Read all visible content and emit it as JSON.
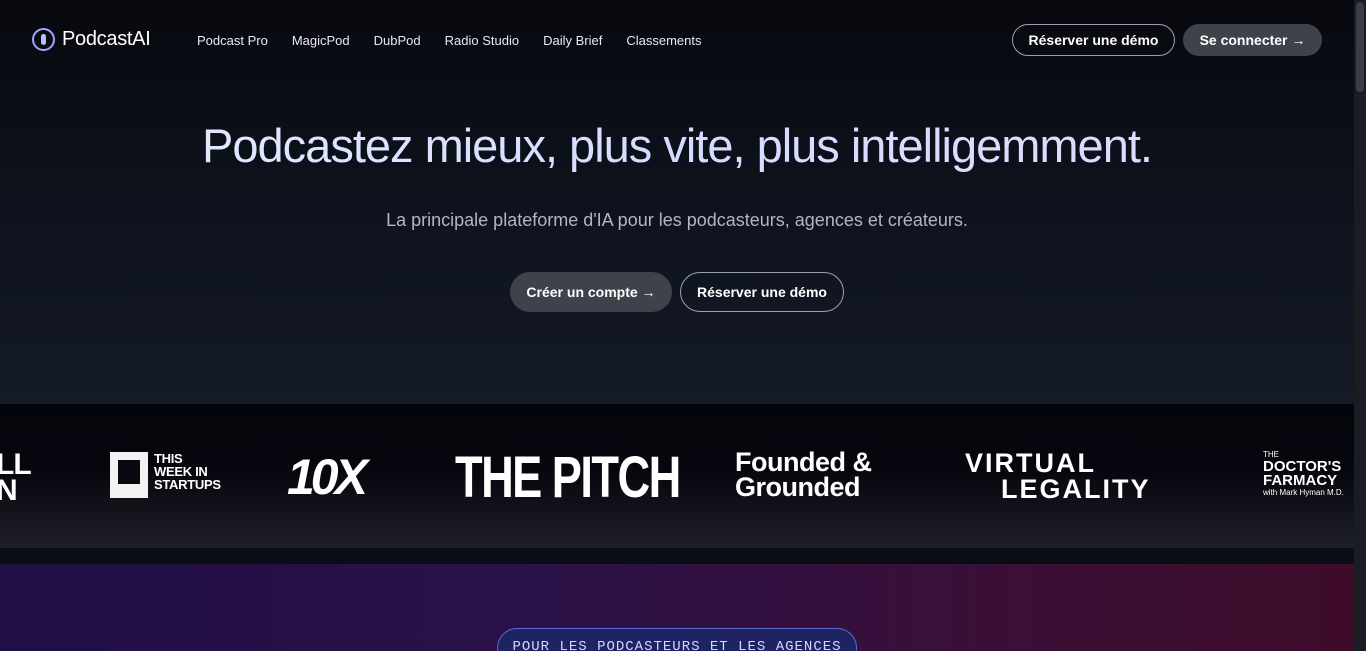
{
  "nav": {
    "logo_text": "PodcastAI",
    "links": [
      "Podcast Pro",
      "MagicPod",
      "DubPod",
      "Radio Studio",
      "Daily Brief",
      "Classements"
    ],
    "demo_label": "Réserver une démo",
    "login_label": "Se connecter →"
  },
  "hero": {
    "headline": "Podcastez mieux, plus vite, plus intelligemment.",
    "subtitle": "La principale plateforme d'IA pour les podcasteurs, agences et créateurs.",
    "cta_create": "Créer un compte →",
    "cta_demo": "Réserver une démo"
  },
  "logos": {
    "cut_logo": "LL\nN",
    "twis": [
      "THIS",
      "WEEK IN",
      "STARTUPS"
    ],
    "tenx": "10X",
    "pitch": "THE PITCH",
    "founded": [
      "Founded &",
      "Grounded"
    ],
    "virtual": [
      "VIRTUAL",
      "LEGALITY"
    ],
    "doctor": [
      "THE",
      "DOCTOR'S",
      "FARMACY",
      "with Mark Hyman M.D."
    ]
  },
  "section2": {
    "pill_label": "POUR LES PODCASTEURS ET LES AGENCES"
  }
}
